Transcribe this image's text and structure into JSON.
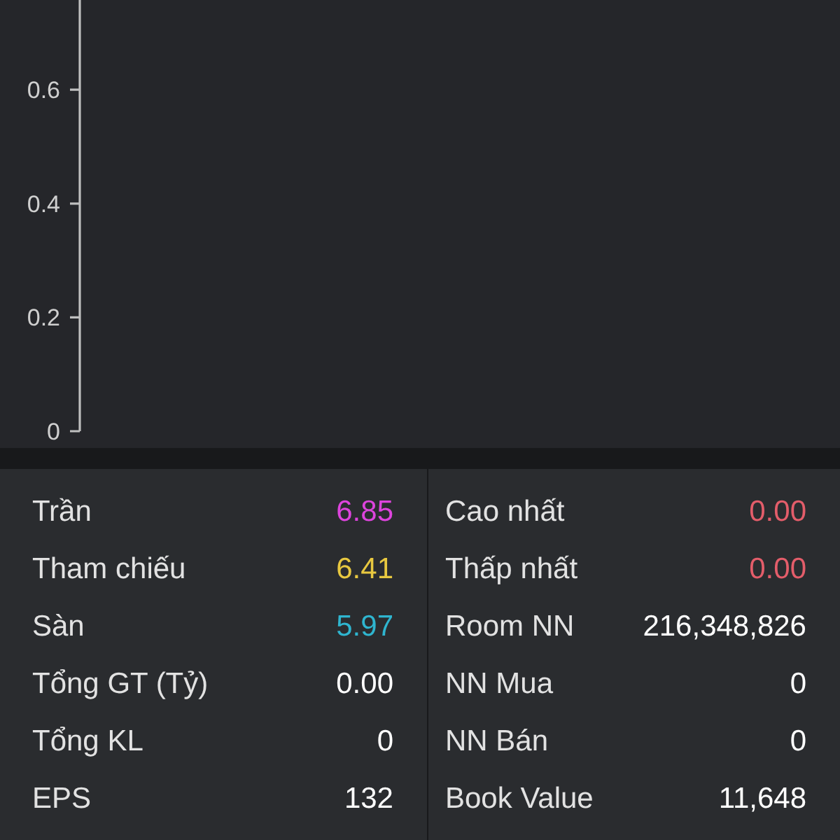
{
  "chart": {
    "y_axis_labels": [
      "0.6",
      "0.4",
      "0.2",
      "0"
    ]
  },
  "stats": {
    "left": [
      {
        "label": "Trần",
        "value": "6.85",
        "color": "#dd44dd"
      },
      {
        "label": "Tham chiếu",
        "value": "6.41",
        "color": "#e8c840"
      },
      {
        "label": "Sàn",
        "value": "5.97",
        "color": "#2fb5cf"
      },
      {
        "label": "Tổng GT (Tỷ)",
        "value": "0.00",
        "color": "#ffffff"
      },
      {
        "label": "Tổng KL",
        "value": "0",
        "color": "#ffffff"
      },
      {
        "label": "EPS",
        "value": "132",
        "color": "#ffffff"
      }
    ],
    "right": [
      {
        "label": "Cao nhất",
        "value": "0.00",
        "color": "#e35d6a"
      },
      {
        "label": "Thấp nhất",
        "value": "0.00",
        "color": "#e35d6a"
      },
      {
        "label": "Room NN",
        "value": "216,348,826",
        "color": "#ffffff"
      },
      {
        "label": "NN Mua",
        "value": "0",
        "color": "#ffffff"
      },
      {
        "label": "NN Bán",
        "value": "0",
        "color": "#ffffff"
      },
      {
        "label": "Book Value",
        "value": "11,648",
        "color": "#ffffff"
      }
    ]
  }
}
